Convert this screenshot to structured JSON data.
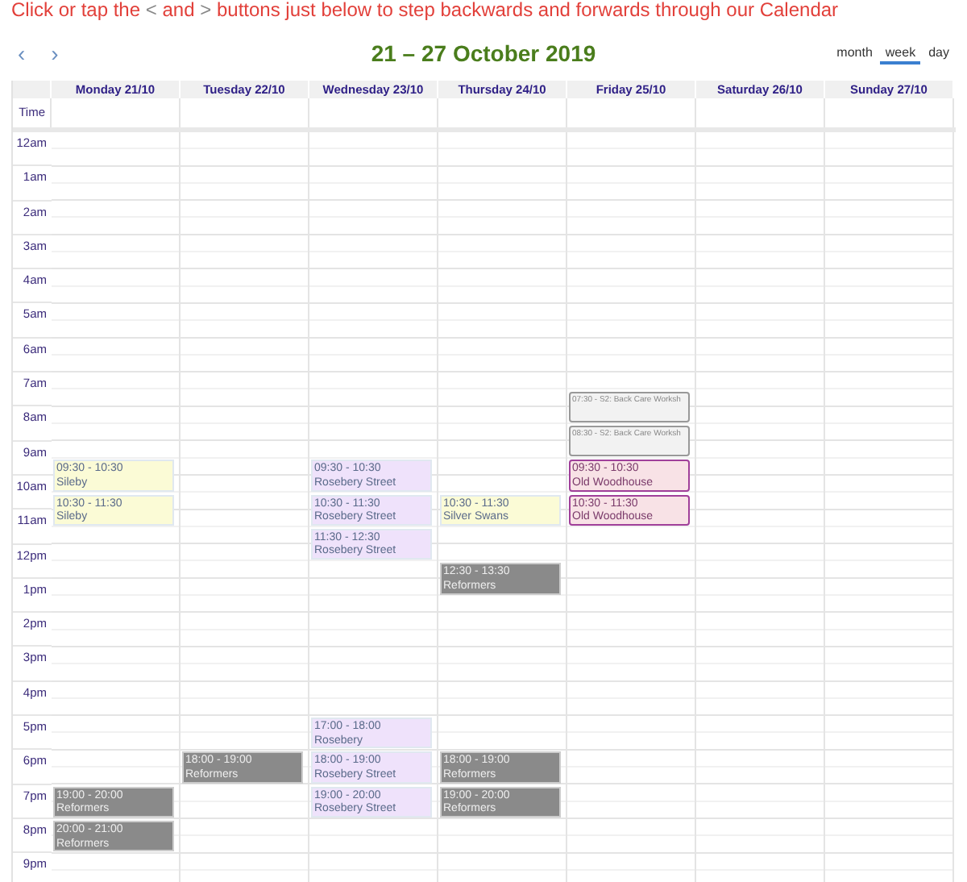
{
  "instruction": [
    {
      "kind": "text",
      "text": "Click or tap the"
    },
    {
      "kind": "symbol",
      "text": "<"
    },
    {
      "kind": "text",
      "text": "and"
    },
    {
      "kind": "symbol",
      "text": ">"
    },
    {
      "kind": "text",
      "text": "buttons just below to step backwards and forwards through our Calendar"
    }
  ],
  "nav": {
    "prev": "‹",
    "next": "›",
    "title": "21 – 27 October 2019"
  },
  "views": [
    {
      "label": "month",
      "selected": false
    },
    {
      "label": "week",
      "selected": true
    },
    {
      "label": "day",
      "selected": false
    }
  ],
  "time_label": "Time",
  "hours": [
    "12am",
    "1am",
    "2am",
    "3am",
    "4am",
    "5am",
    "6am",
    "7am",
    "8am",
    "9am",
    "10am",
    "11am",
    "12pm",
    "1pm",
    "2pm",
    "3pm",
    "4pm",
    "5pm",
    "6pm",
    "7pm",
    "8pm",
    "9pm"
  ],
  "days": [
    {
      "label": "Monday 21/10",
      "events": [
        {
          "kind": "class",
          "color": "#fbfbd6",
          "time": "09:30 - 10:30",
          "name": "Sileby"
        },
        {
          "kind": "class",
          "color": "#fbfbd6",
          "time": "10:30 - 11:30",
          "name": "Sileby"
        },
        {
          "kind": "reformer",
          "color": "#8a8a8a",
          "time": "19:00 - 20:00",
          "name": "Reformers"
        },
        {
          "kind": "reformer",
          "color": "#8a8a8a",
          "time": "20:00 - 21:00",
          "name": "Reformers"
        }
      ]
    },
    {
      "label": "Tuesday 22/10",
      "events": [
        {
          "kind": "reformer",
          "color": "#8a8a8a",
          "time": "18:00 - 19:00",
          "name": "Reformers"
        }
      ]
    },
    {
      "label": "Wednesday 23/10",
      "events": [
        {
          "kind": "class",
          "color": "#efe2fb",
          "time": "09:30 - 10:30",
          "name": "Rosebery Street"
        },
        {
          "kind": "class",
          "color": "#efe2fb",
          "time": "10:30 - 11:30",
          "name": "Rosebery Street"
        },
        {
          "kind": "class",
          "color": "#efe2fb",
          "time": "11:30 - 12:30",
          "name": "Rosebery Street"
        },
        {
          "kind": "class",
          "color": "#efe2fb",
          "time": "17:00 - 18:00",
          "name": "Rosebery"
        },
        {
          "kind": "class",
          "color": "#efe2fb",
          "time": "18:00 - 19:00",
          "name": "Rosebery Street"
        },
        {
          "kind": "class",
          "color": "#efe2fb",
          "time": "19:00 - 20:00",
          "name": "Rosebery Street"
        }
      ]
    },
    {
      "label": "Thursday 24/10",
      "events": [
        {
          "kind": "class",
          "color": "#fbfbd6",
          "time": "10:30 - 11:30",
          "name": "Silver Swans"
        },
        {
          "kind": "reformer",
          "color": "#8a8a8a",
          "time": "12:30 - 13:30",
          "name": "Reformers"
        },
        {
          "kind": "reformer",
          "color": "#8a8a8a",
          "time": "18:00 - 19:00",
          "name": "Reformers"
        },
        {
          "kind": "reformer",
          "color": "#8a8a8a",
          "time": "19:00 - 20:00",
          "name": "Reformers"
        }
      ]
    },
    {
      "label": "Friday 25/10",
      "events": [
        {
          "kind": "workshop",
          "color": "#f2f2f2",
          "time": "07:30 - S2: Back Care Worksh"
        },
        {
          "kind": "workshop",
          "color": "#f2f2f2",
          "time": "08:30 - S2: Back Care Worksh"
        },
        {
          "kind": "private",
          "color": "#f8e2e6",
          "time": "09:30 - 10:30",
          "name": "Old Woodhouse"
        },
        {
          "kind": "private",
          "color": "#f8e2e6",
          "time": "10:30 - 11:30",
          "name": "Old Woodhouse"
        }
      ]
    },
    {
      "label": "Saturday 26/10"
    },
    {
      "label": "Sunday 27/10"
    }
  ]
}
